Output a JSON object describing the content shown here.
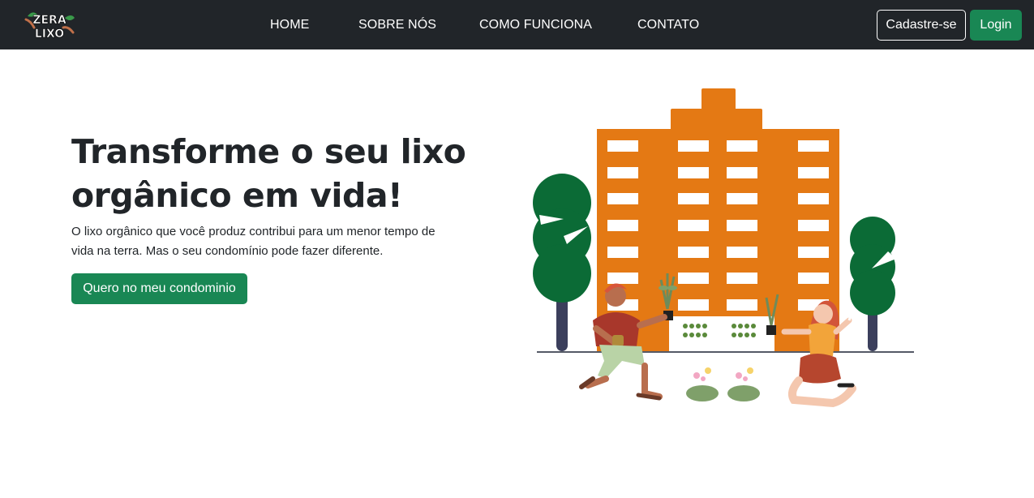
{
  "navbar": {
    "logo": {
      "line1": "ZERA",
      "line2": "LIXO"
    },
    "links": [
      "HOME",
      "SOBRE NÓS",
      "COMO FUNCIONA",
      "CONTATO"
    ],
    "signup_label": "Cadastre-se",
    "login_label": "Login"
  },
  "hero": {
    "title": "Transforme o seu lixo orgânico em vida!",
    "text": "O lixo orgânico que você produz contribui para um menor tempo de vida na terra. Mas o seu condomínio pode fazer diferente.",
    "cta_label": "Quero no meu condominio"
  },
  "colors": {
    "navbar_bg": "#212529",
    "primary_green": "#198754",
    "building_orange": "#E47914",
    "tree_green": "#0B6B36"
  }
}
